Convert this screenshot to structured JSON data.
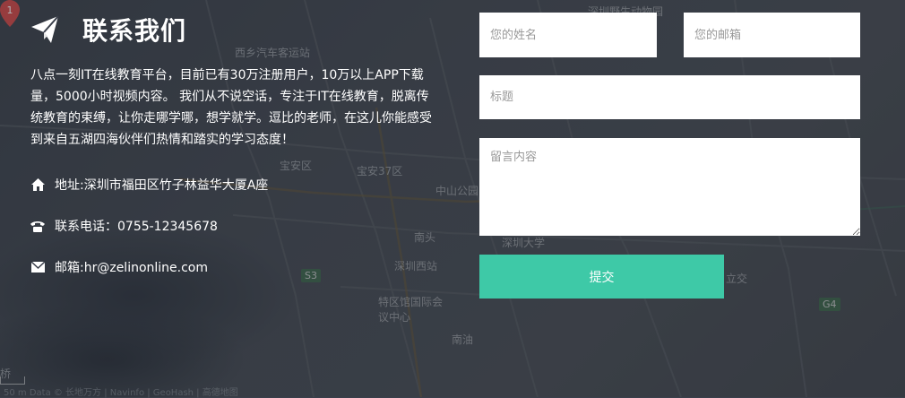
{
  "contact": {
    "title": "联系我们",
    "description": "八点一刻IT在线教育平台，目前已有30万注册用户，10万以上APP下载量，5000小时视频内容。 我们从不说空话，专注于IT在线教育，脱离传统教育的束缚，让你走哪学哪，想学就学。逗比的老师，在这儿你能感受到来自五湖四海伙伴们热情和踏实的学习态度！",
    "address": "地址:深圳市福田区竹子林益华大厦A座",
    "phone": "联系电话：0755-12345678",
    "email": "邮箱:hr@zelinonline.com",
    "icons": {
      "title": "paper-plane-icon",
      "address": "home-icon",
      "phone": "phone-icon",
      "email": "envelope-icon"
    }
  },
  "form": {
    "name_placeholder": "您的姓名",
    "email_placeholder": "您的邮箱",
    "subject_placeholder": "标题",
    "message_placeholder": "留言内容",
    "submit_label": "提交"
  },
  "map": {
    "labels": [
      "西乡汽车客运站",
      "深圳野生动物园",
      "宝安区",
      "宝安37区",
      "中山公园",
      "南头",
      "深圳大学",
      "深圳西站",
      "特区馆国际会议中心",
      "南油",
      "立交",
      "桥"
    ],
    "badges": [
      "G4",
      "S3"
    ],
    "footer": "50 m  Data © 长地万方 | Navinfo | GeoHash | 高德地图"
  },
  "colors": {
    "accent": "#3ec9a7",
    "text": "#ffffff"
  }
}
